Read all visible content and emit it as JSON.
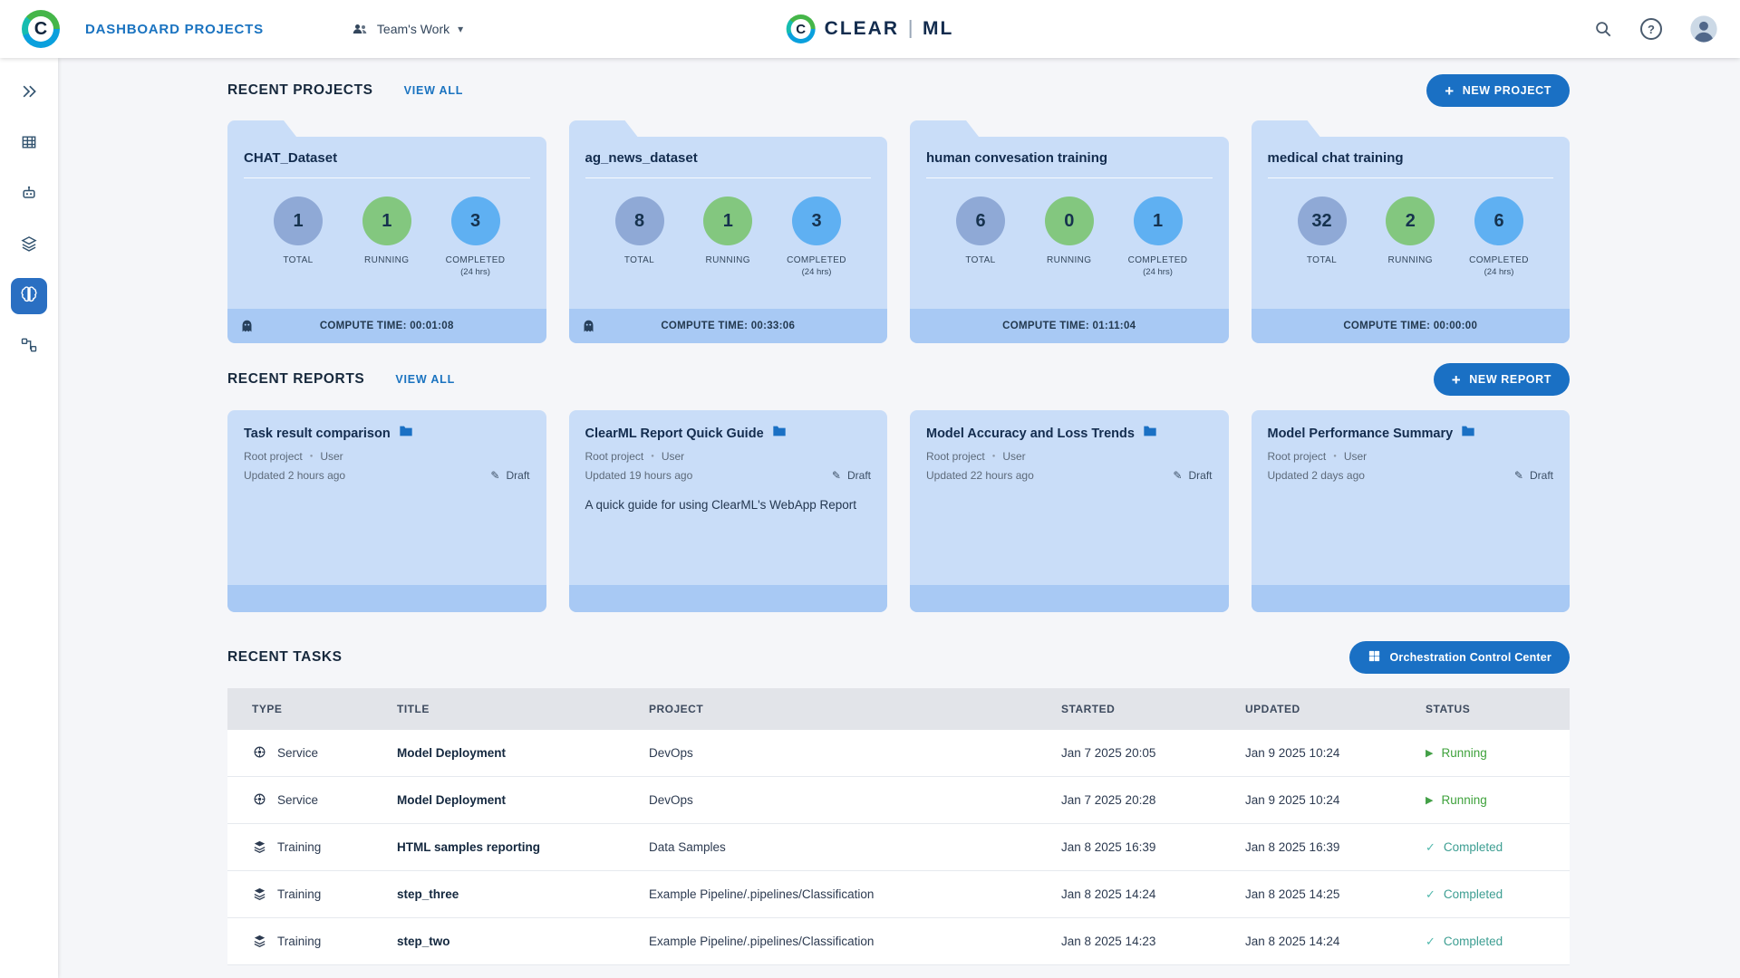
{
  "icons": {
    "plus": "+",
    "caret_down": "▾",
    "dot": "●",
    "pencil": "✎",
    "play": "▶",
    "check": "✓",
    "help": "?",
    "logo_letter": "C"
  },
  "header": {
    "title": "DASHBOARD PROJECTS",
    "workspace": "Team's Work",
    "logo_clear": "CLEAR",
    "logo_ml": "ML"
  },
  "projects": {
    "title": "RECENT PROJECTS",
    "view_all": "VIEW ALL",
    "new_button": "NEW PROJECT",
    "labels": {
      "total": "TOTAL",
      "running": "RUNNING",
      "completed": "COMPLETED",
      "window": "(24 hrs)"
    },
    "cards": [
      {
        "name": "CHAT_Dataset",
        "total": "1",
        "running": "1",
        "completed": "3",
        "compute": "COMPUTE TIME: 00:01:08"
      },
      {
        "name": "ag_news_dataset",
        "total": "8",
        "running": "1",
        "completed": "3",
        "compute": "COMPUTE TIME: 00:33:06"
      },
      {
        "name": "human convesation training",
        "total": "6",
        "running": "0",
        "completed": "1",
        "compute": "COMPUTE TIME: 01:11:04"
      },
      {
        "name": "medical chat training",
        "total": "32",
        "running": "2",
        "completed": "6",
        "compute": "COMPUTE TIME: 00:00:00"
      }
    ]
  },
  "reports": {
    "title": "RECENT REPORTS",
    "view_all": "VIEW ALL",
    "new_button": "NEW REPORT",
    "cards": [
      {
        "title": "Task result comparison",
        "project": "Root project",
        "user": "User",
        "updated": "Updated 2 hours ago",
        "badge": "Draft"
      },
      {
        "title": "ClearML Report Quick Guide",
        "project": "Root project",
        "user": "User",
        "updated": "Updated 19 hours ago",
        "badge": "Draft",
        "description": "A quick guide for using ClearML's WebApp Report"
      },
      {
        "title": "Model Accuracy and Loss Trends",
        "project": "Root project",
        "user": "User",
        "updated": "Updated 22 hours ago",
        "badge": "Draft"
      },
      {
        "title": "Model Performance Summary",
        "project": "Root project",
        "user": "User",
        "updated": "Updated 2 days ago",
        "badge": "Draft"
      }
    ]
  },
  "tasks": {
    "title": "RECENT TASKS",
    "orchestration_button": "Orchestration Control Center",
    "columns": [
      "TYPE",
      "TITLE",
      "PROJECT",
      "STARTED",
      "UPDATED",
      "STATUS"
    ],
    "rows": [
      {
        "type": "Service",
        "title": "Model Deployment",
        "project": "DevOps",
        "started": "Jan 7 2025 20:05",
        "updated": "Jan 9 2025 10:24",
        "status": "Running"
      },
      {
        "type": "Service",
        "title": "Model Deployment",
        "project": "DevOps",
        "started": "Jan 7 2025 20:28",
        "updated": "Jan 9 2025 10:24",
        "status": "Running"
      },
      {
        "type": "Training",
        "title": "HTML samples reporting",
        "project": "Data Samples",
        "started": "Jan 8 2025 16:39",
        "updated": "Jan 8 2025 16:39",
        "status": "Completed"
      },
      {
        "type": "Training",
        "title": "step_three",
        "project": "Example Pipeline/.pipelines/Classification",
        "started": "Jan 8 2025 14:24",
        "updated": "Jan 8 2025 14:25",
        "status": "Completed"
      },
      {
        "type": "Training",
        "title": "step_two",
        "project": "Example Pipeline/.pipelines/Classification",
        "started": "Jan 8 2025 14:23",
        "updated": "Jan 8 2025 14:24",
        "status": "Completed"
      }
    ]
  },
  "colors": {
    "accent": "#1a70c4",
    "card": "#c9ddf8",
    "card_strip": "#a8c9f4",
    "running_green": "#43a047",
    "completed_teal": "#3d9e92"
  }
}
